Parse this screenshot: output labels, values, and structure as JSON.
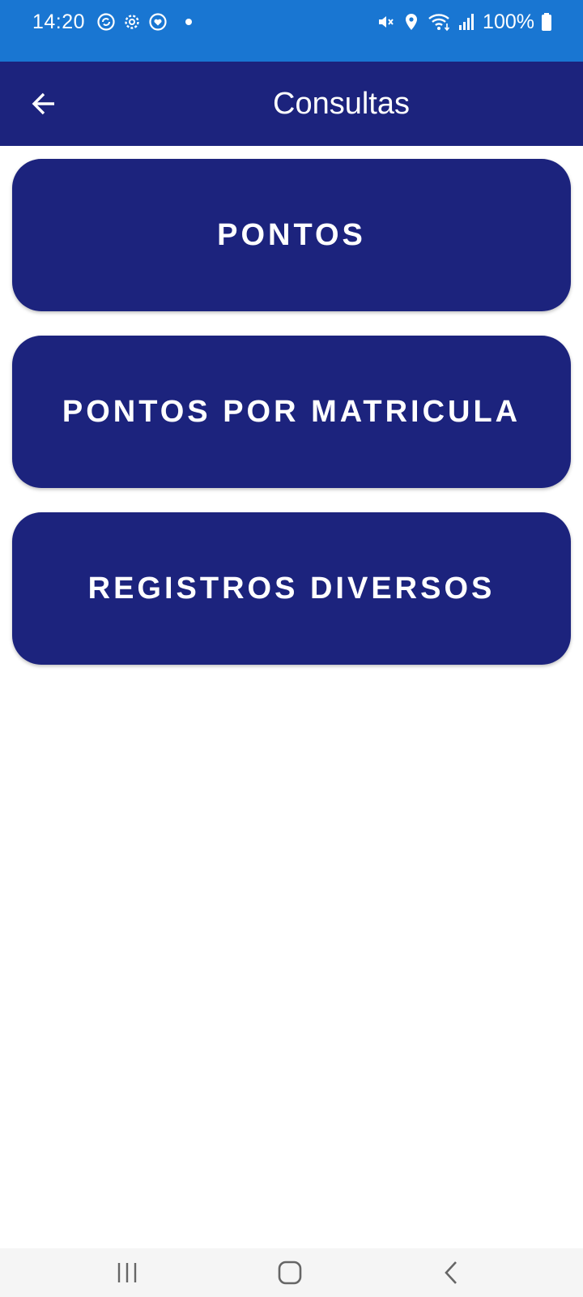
{
  "status_bar": {
    "time": "14:20",
    "battery": "100%",
    "icons": [
      "sync-badge-icon",
      "settings-icon",
      "heart-badge-icon",
      "notification-dot",
      "mute-icon",
      "location-icon",
      "wifi-icon",
      "signal-icon",
      "battery-icon"
    ]
  },
  "app_bar": {
    "title": "Consultas",
    "back_icon": "arrow-left-icon"
  },
  "menu": {
    "items": [
      {
        "label": "PONTOS"
      },
      {
        "label": "PONTOS POR MATRICULA"
      },
      {
        "label": "REGISTROS DIVERSOS"
      }
    ]
  },
  "nav_bar": {
    "icons": [
      "recents-icon",
      "home-icon",
      "back-icon"
    ]
  },
  "colors": {
    "status_bar": "#1976d2",
    "primary": "#1c237d",
    "on_primary": "#ffffff",
    "background": "#ffffff",
    "nav_bar": "#f5f5f5",
    "nav_icon": "#666666"
  }
}
